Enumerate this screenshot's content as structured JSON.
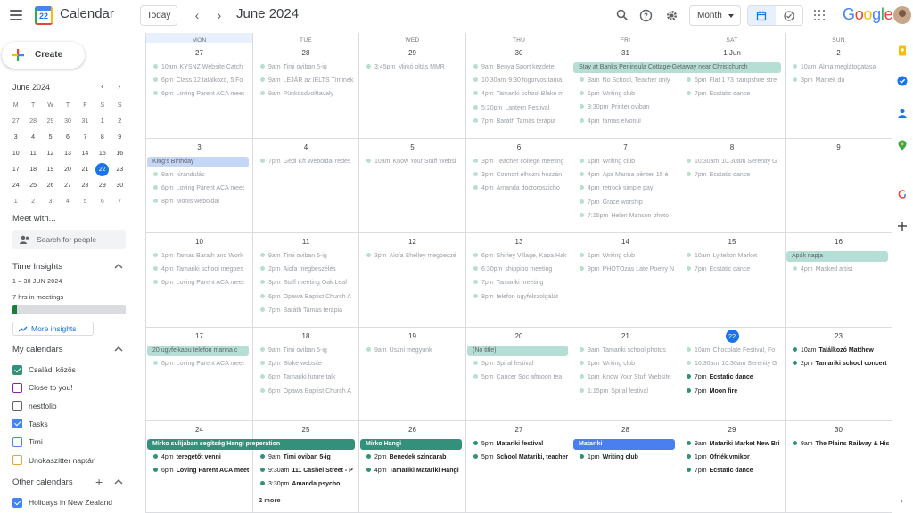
{
  "header": {
    "app_title": "Calendar",
    "logo_day": "22",
    "today_label": "Today",
    "prev_arrow": "‹",
    "next_arrow": "›",
    "month_title": "June 2024",
    "view_label": "Month",
    "brand": "Google"
  },
  "sidebar": {
    "create_label": "Create",
    "mini_month_title": "June 2024",
    "mini_prev": "‹",
    "mini_next": "›",
    "mini_weekday_heads": [
      "M",
      "T",
      "W",
      "T",
      "F",
      "S",
      "S"
    ],
    "mini_weeks": [
      [
        "27",
        "28",
        "29",
        "30",
        "31",
        "1",
        "2"
      ],
      [
        "3",
        "4",
        "5",
        "6",
        "7",
        "8",
        "9"
      ],
      [
        "10",
        "11",
        "12",
        "13",
        "14",
        "15",
        "16"
      ],
      [
        "17",
        "18",
        "19",
        "20",
        "21",
        "22",
        "23"
      ],
      [
        "24",
        "25",
        "26",
        "27",
        "28",
        "29",
        "30"
      ],
      [
        "1",
        "2",
        "3",
        "4",
        "5",
        "6",
        "7"
      ]
    ],
    "meet_with_title": "Meet with...",
    "search_people_placeholder": "Search for people",
    "time_insights_title": "Time Insights",
    "insights_range": "1 – 30 JUN 2024",
    "insights_hours": "7 hrs in meetings",
    "insights_fill_fraction": 0.04,
    "more_insights_label": "More insights",
    "my_calendars_title": "My calendars",
    "my_calendars": [
      {
        "label": "Családi közös",
        "color": "#33907a",
        "checked": true
      },
      {
        "label": "Close to you!",
        "color": "#8e24aa",
        "checked": false
      },
      {
        "label": "nestfolio",
        "color": "#616161",
        "checked": false
      },
      {
        "label": "Tasks",
        "color": "#4285f4",
        "checked": true
      },
      {
        "label": "Timi",
        "color": "#4285f4",
        "checked": false
      },
      {
        "label": "Unokaszitter naptár",
        "color": "#e8a33d",
        "checked": false
      }
    ],
    "other_calendars_title": "Other calendars",
    "other_calendars": [
      {
        "label": "Holidays in New Zealand",
        "color": "#4285f4",
        "checked": true
      }
    ]
  },
  "grid": {
    "weekday_heads": [
      "MON",
      "TUE",
      "WED",
      "THU",
      "FRI",
      "SAT",
      "SUN"
    ],
    "weeks": [
      {
        "days": [
          "27",
          "28",
          "29",
          "30",
          "31",
          "1 Jun",
          "2"
        ],
        "bars": [
          {
            "text": "Stay at Banks Peninsula Cottage-Getaway near Christchurch",
            "start": 4,
            "span": 2,
            "style": "g-past"
          }
        ],
        "events": [
          [
            {
              "t": "10am",
              "x": "KYSNZ Website Catch",
              "s": "past"
            },
            {
              "t": "6pm",
              "x": "Class 12 találkozó, 5 Fo",
              "s": "past"
            },
            {
              "t": "6pm",
              "x": "Loving Parent ACA meet",
              "s": "past"
            }
          ],
          [
            {
              "t": "9am",
              "x": "Timi oviban 5-ig",
              "s": "past"
            },
            {
              "t": "9am",
              "x": "LEJÁR az IELTS Tíminek",
              "s": "past"
            },
            {
              "t": "9am",
              "x": "Pünkösdvolttavaly",
              "s": "past"
            }
          ],
          [
            {
              "t": "3:45pm",
              "x": "Mirkó oltás MMR",
              "s": "past"
            }
          ],
          [
            {
              "t": "9am",
              "x": "Benya Sport kezdete",
              "s": "past"
            },
            {
              "t": "10:30am",
              "x": "9:30 fogorvos tamá",
              "s": "past"
            },
            {
              "t": "4pm",
              "x": "Tamariki school Blake m",
              "s": "past"
            },
            {
              "t": "5:20pm",
              "x": "Lantern Festival",
              "s": "past"
            },
            {
              "t": "7pm",
              "x": "Baráth Tamás terápia",
              "s": "past"
            }
          ],
          [
            {
              "t": "9am",
              "x": "No School, Teacher only",
              "s": "past"
            },
            {
              "t": "1pm",
              "x": "Writing club",
              "s": "past"
            },
            {
              "t": "3:30pm",
              "x": "Printer oviban",
              "s": "past"
            },
            {
              "t": "4pm",
              "x": "tamas elvonul",
              "s": "past"
            }
          ],
          [
            {
              "t": "6pm",
              "x": "Flat 1 73 hampshire stre",
              "s": "past"
            },
            {
              "t": "7pm",
              "x": "Ecstatic dance",
              "s": "past"
            }
          ],
          [
            {
              "t": "10am",
              "x": "Alma meglátogatása",
              "s": "past"
            },
            {
              "t": "3pm",
              "x": "Mártiék du",
              "s": "past"
            }
          ]
        ]
      },
      {
        "days": [
          "3",
          "4",
          "5",
          "6",
          "7",
          "8",
          "9"
        ],
        "bars": [
          {
            "text": "King's Birthday",
            "start": 0,
            "span": 1,
            "style": "b-past"
          }
        ],
        "events": [
          [
            {
              "t": "9am",
              "x": "kirándulás",
              "s": "past"
            },
            {
              "t": "6pm",
              "x": "Loving Parent ACA meet",
              "s": "past"
            },
            {
              "t": "8pm",
              "x": "Monis weboldal",
              "s": "past"
            }
          ],
          [
            {
              "t": "7pm",
              "x": "Gedi Kft Weboldal redes",
              "s": "past"
            }
          ],
          [
            {
              "t": "10am",
              "x": "Know Your Stuff Websi",
              "s": "past"
            }
          ],
          [
            {
              "t": "3pm",
              "x": "Teacher college meeting",
              "s": "past"
            },
            {
              "t": "3pm",
              "x": "Connort elhozni hozzán",
              "s": "past"
            },
            {
              "t": "4pm",
              "x": "Amanda doctorpszicho",
              "s": "past"
            }
          ],
          [
            {
              "t": "1pm",
              "x": "Writing club",
              "s": "past"
            },
            {
              "t": "4pm",
              "x": "Apa Manna pénteк 15 é",
              "s": "past"
            },
            {
              "t": "4pm",
              "x": "retrock simple pay",
              "s": "past"
            },
            {
              "t": "7pm",
              "x": "Grace worship",
              "s": "past"
            },
            {
              "t": "7:15pm",
              "x": "Helen Manson photo",
              "s": "past"
            }
          ],
          [
            {
              "t": "10:30am",
              "x": "10.30am Serenity G",
              "s": "past"
            },
            {
              "t": "7pm",
              "x": "Ecstatic dance",
              "s": "past"
            }
          ],
          []
        ]
      },
      {
        "days": [
          "10",
          "11",
          "12",
          "13",
          "14",
          "15",
          "16"
        ],
        "bars": [
          {
            "text": "Apák napja",
            "start": 6,
            "span": 1,
            "style": "g-past"
          }
        ],
        "events": [
          [
            {
              "t": "1pm",
              "x": "Tamas Barath and Work",
              "s": "past"
            },
            {
              "t": "4pm",
              "x": "Tamariki school megbes",
              "s": "past"
            },
            {
              "t": "6pm",
              "x": "Loving Parent ACA meet",
              "s": "past"
            }
          ],
          [
            {
              "t": "9am",
              "x": "Timi oviban 5-ig",
              "s": "past"
            },
            {
              "t": "2pm",
              "x": "Aiofa megbeszélés",
              "s": "past"
            },
            {
              "t": "3pm",
              "x": "Staff meeting Oak Leaf",
              "s": "past"
            },
            {
              "t": "6pm",
              "x": "Opawa Baptist Church A",
              "s": "past"
            },
            {
              "t": "7pm",
              "x": "Baráth Tamás terápia",
              "s": "past"
            }
          ],
          [
            {
              "t": "3pm",
              "x": "Aiofa Shelley megbeszé",
              "s": "past"
            }
          ],
          [
            {
              "t": "6pm",
              "x": "Shirley Village, Kapa Hak",
              "s": "past"
            },
            {
              "t": "6:30pm",
              "x": "shippibo meeting",
              "s": "past"
            },
            {
              "t": "7pm",
              "x": "Tamariki meeting",
              "s": "past"
            },
            {
              "t": "8pm",
              "x": "telefon ugyfelszolgálat",
              "s": "past"
            }
          ],
          [
            {
              "t": "1pm",
              "x": "Writing club",
              "s": "past"
            },
            {
              "t": "9pm",
              "x": "PHOTOzás Late Poetry N",
              "s": "past"
            }
          ],
          [
            {
              "t": "10am",
              "x": "Lyttelton Market",
              "s": "past"
            },
            {
              "t": "7pm",
              "x": "Ecstatic dance",
              "s": "past"
            }
          ],
          [
            {
              "t": "4pm",
              "x": "Masked artist",
              "s": "past"
            }
          ]
        ]
      },
      {
        "days": [
          "17",
          "18",
          "19",
          "20",
          "21",
          "22",
          "23"
        ],
        "bars": [
          {
            "text": "20 ugyfelkapu telefon manna c",
            "start": 0,
            "span": 1,
            "style": "g-past"
          },
          {
            "text": "(No title)",
            "start": 3,
            "span": 1,
            "style": "g-past"
          }
        ],
        "events": [
          [
            {
              "t": "6pm",
              "x": "Loving Parent ACA meet",
              "s": "past"
            }
          ],
          [
            {
              "t": "9am",
              "x": "Timi oviban 5-ig",
              "s": "past"
            },
            {
              "t": "2pm",
              "x": "Blake website",
              "s": "past"
            },
            {
              "t": "6pm",
              "x": "Tamariki future talk",
              "s": "past"
            },
            {
              "t": "6pm",
              "x": "Opawa Baptist Church A",
              "s": "past"
            }
          ],
          [
            {
              "t": "9am",
              "x": "Uszni megyunk",
              "s": "past"
            }
          ],
          [
            {
              "t": "5pm",
              "x": "Spiral festival",
              "s": "past"
            },
            {
              "t": "5pm",
              "x": "Cancer Soc aftnoon tea",
              "s": "past"
            }
          ],
          [
            {
              "t": "9am",
              "x": "Tamariki school photos",
              "s": "past"
            },
            {
              "t": "1pm",
              "x": "Writing club",
              "s": "past"
            },
            {
              "t": "1pm",
              "x": "Know Your Stuff Website",
              "s": "past"
            },
            {
              "t": "1:15pm",
              "x": "Spiral festival",
              "s": "past"
            }
          ],
          [
            {
              "t": "10am",
              "x": "Chocolate Festival, Fo",
              "s": "past"
            },
            {
              "t": "10:30am",
              "x": "10.30am Serenity G",
              "s": "past"
            },
            {
              "t": "7pm",
              "x": "Ecstatic dance",
              "s": "cur"
            },
            {
              "t": "7pm",
              "x": "Moon fire",
              "s": "cur"
            }
          ],
          [
            {
              "t": "10am",
              "x": "Találkozó Matthew",
              "s": "cur"
            },
            {
              "t": "2pm",
              "x": "Tamariki school concert",
              "s": "cur"
            }
          ]
        ]
      },
      {
        "days": [
          "24",
          "25",
          "26",
          "27",
          "28",
          "29",
          "30"
        ],
        "bars": [
          {
            "text": "Mirko sulijában segítség Hangi preperation",
            "start": 0,
            "span": 2,
            "style": "g-cur"
          },
          {
            "text": "Mirko Hangi",
            "start": 2,
            "span": 1,
            "style": "g-cur"
          },
          {
            "text": "Matariki",
            "start": 4,
            "span": 1,
            "style": "b-cur"
          }
        ],
        "events": [
          [
            {
              "t": "4pm",
              "x": "teregetőt venni",
              "s": "cur"
            },
            {
              "t": "6pm",
              "x": "Loving Parent ACA meet",
              "s": "cur"
            }
          ],
          [
            {
              "t": "9am",
              "x": "Timi oviban 5-ig",
              "s": "cur"
            },
            {
              "t": "9:30am",
              "x": "111 Cashel Street - P",
              "s": "cur"
            },
            {
              "t": "3:30pm",
              "x": "Amanda psycho",
              "s": "cur"
            }
          ],
          [
            {
              "t": "2pm",
              "x": "Benedek színdarab",
              "s": "cur"
            },
            {
              "t": "4pm",
              "x": "Tamariki Matariki Hangi",
              "s": "cur"
            }
          ],
          [
            {
              "t": "5pm",
              "x": "Matariki festival",
              "s": "cur"
            },
            {
              "t": "5pm",
              "x": "School Matariki, teacher",
              "s": "cur"
            }
          ],
          [
            {
              "t": "1pm",
              "x": "Writing club",
              "s": "cur"
            }
          ],
          [
            {
              "t": "9am",
              "x": "Matariki Market New Bri",
              "s": "cur"
            },
            {
              "t": "1pm",
              "x": "Ofriék vmikor",
              "s": "cur"
            },
            {
              "t": "7pm",
              "x": "Ecstatic dance",
              "s": "cur"
            }
          ],
          [
            {
              "t": "9am",
              "x": "The Plains Railway & His",
              "s": "cur"
            }
          ]
        ],
        "more": {
          "col": 1,
          "text": "2 more"
        }
      }
    ]
  },
  "icons": {
    "menu": "menu-icon",
    "search": "search-icon",
    "help": "help-icon",
    "settings": "gear-icon",
    "calendar_view": "calendar-icon",
    "tasks_view": "check-circle-icon",
    "apps": "apps-grid-icon"
  }
}
